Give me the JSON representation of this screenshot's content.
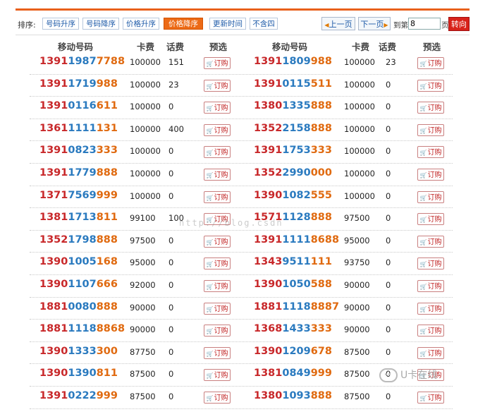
{
  "toolbar": {
    "sort_label": "排序:",
    "sort_buttons": [
      "号码升序",
      "号码降序",
      "价格升序",
      "价格降序",
      "更新时间",
      "不含四"
    ],
    "active_sort": "价格降序",
    "prev_page": "上一页",
    "next_page": "下一页",
    "goto_label": "到第",
    "page_value": "8",
    "page_unit": "页",
    "go_button": "转向"
  },
  "table": {
    "headers": [
      "移动号码",
      "卡费",
      "话费",
      "预选",
      "移动号码",
      "卡费",
      "话费",
      "预选"
    ],
    "order_label": "订购",
    "rows": [
      [
        {
          "n": [
            "1391",
            "1987",
            "7788"
          ],
          "fee": "100000",
          "call": "151"
        },
        {
          "n": [
            "1391",
            "1809",
            "988"
          ],
          "fee": "100000",
          "call": "23"
        }
      ],
      [
        {
          "n": [
            "1391",
            "1719",
            "988"
          ],
          "fee": "100000",
          "call": "23"
        },
        {
          "n": [
            "1391",
            "0115",
            "511"
          ],
          "fee": "100000",
          "call": "0"
        }
      ],
      [
        {
          "n": [
            "1391",
            "0116",
            "611"
          ],
          "fee": "100000",
          "call": "0"
        },
        {
          "n": [
            "1380",
            "1335",
            "888"
          ],
          "fee": "100000",
          "call": "0"
        }
      ],
      [
        {
          "n": [
            "1361",
            "1111",
            "131"
          ],
          "fee": "100000",
          "call": "400"
        },
        {
          "n": [
            "1352",
            "2158",
            "888"
          ],
          "fee": "100000",
          "call": "0"
        }
      ],
      [
        {
          "n": [
            "1391",
            "0823",
            "333"
          ],
          "fee": "100000",
          "call": "0"
        },
        {
          "n": [
            "1391",
            "1753",
            "333"
          ],
          "fee": "100000",
          "call": "0"
        }
      ],
      [
        {
          "n": [
            "1391",
            "1779",
            "888"
          ],
          "fee": "100000",
          "call": "0"
        },
        {
          "n": [
            "1352",
            "2990",
            "000"
          ],
          "fee": "100000",
          "call": "0"
        }
      ],
      [
        {
          "n": [
            "1371",
            "7569",
            "999"
          ],
          "fee": "100000",
          "call": "0"
        },
        {
          "n": [
            "1390",
            "1082",
            "555"
          ],
          "fee": "100000",
          "call": "0"
        }
      ],
      [
        {
          "n": [
            "1381",
            "1713",
            "811"
          ],
          "fee": "99100",
          "call": "100"
        },
        {
          "n": [
            "1571",
            "1128",
            "888"
          ],
          "fee": "97500",
          "call": "0"
        }
      ],
      [
        {
          "n": [
            "1352",
            "1798",
            "888"
          ],
          "fee": "97500",
          "call": "0"
        },
        {
          "n": [
            "1391",
            "1111",
            "8688"
          ],
          "fee": "95000",
          "call": "0"
        }
      ],
      [
        {
          "n": [
            "1390",
            "1005",
            "168"
          ],
          "fee": "95000",
          "call": "0"
        },
        {
          "n": [
            "1343",
            "9511",
            "111"
          ],
          "fee": "93750",
          "call": "0"
        }
      ],
      [
        {
          "n": [
            "1390",
            "1107",
            "666"
          ],
          "fee": "92000",
          "call": "0"
        },
        {
          "n": [
            "1390",
            "1050",
            "588"
          ],
          "fee": "90000",
          "call": "0"
        }
      ],
      [
        {
          "n": [
            "1881",
            "0080",
            "888"
          ],
          "fee": "90000",
          "call": "0"
        },
        {
          "n": [
            "1881",
            "1118",
            "8887"
          ],
          "fee": "90000",
          "call": "0"
        }
      ],
      [
        {
          "n": [
            "1881",
            "1118",
            "8868"
          ],
          "fee": "90000",
          "call": "0"
        },
        {
          "n": [
            "1368",
            "1433",
            "333"
          ],
          "fee": "90000",
          "call": "0"
        }
      ],
      [
        {
          "n": [
            "1390",
            "1333",
            "300"
          ],
          "fee": "87750",
          "call": "0"
        },
        {
          "n": [
            "1390",
            "1209",
            "678"
          ],
          "fee": "87500",
          "call": "0"
        }
      ],
      [
        {
          "n": [
            "1390",
            "1390",
            "811"
          ],
          "fee": "87500",
          "call": "0"
        },
        {
          "n": [
            "1381",
            "0849",
            "999"
          ],
          "fee": "87500",
          "call": "0"
        }
      ],
      [
        {
          "n": [
            "1391",
            "0222",
            "999"
          ],
          "fee": "87500",
          "call": "0"
        },
        {
          "n": [
            "1380",
            "1093",
            "888"
          ],
          "fee": "87500",
          "call": "0"
        }
      ]
    ]
  },
  "watermark": "http://blog.csdn",
  "logo_text": "U卡在线",
  "colors": {
    "accent": "#ec6a16",
    "prefix": "#c8282a",
    "middle": "#2a7abf",
    "suffix": "#e06a10",
    "go": "#d8221a"
  }
}
